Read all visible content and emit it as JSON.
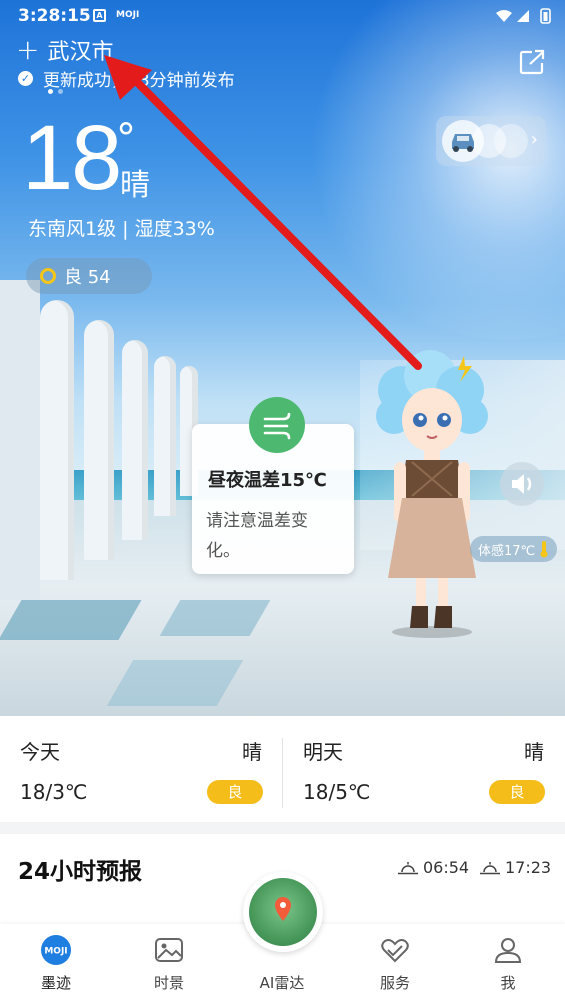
{
  "status_bar": {
    "time": "3:28:15",
    "app_icon_a": "A",
    "app_icon_moji": "MOJI"
  },
  "header": {
    "city": "武汉市",
    "update_status": "更新成功，53分钟前发布",
    "page_count": 2,
    "active_page": 1
  },
  "current": {
    "temperature": "18",
    "degree_symbol": "°",
    "condition": "晴",
    "wind_humidity": "东南风1级 | 湿度33%",
    "aqi": "良 54"
  },
  "tip": {
    "title": "昼夜温差15℃",
    "body": "请注意温差变化。"
  },
  "feels_like": "体感17℃",
  "daily": {
    "today": {
      "name": "今天",
      "condition": "晴",
      "temp": "18/3℃",
      "aqi": "良"
    },
    "tomorrow": {
      "name": "明天",
      "condition": "晴",
      "temp": "18/5℃",
      "aqi": "良"
    }
  },
  "hourly": {
    "title": "24小时预报",
    "sunrise": "06:54",
    "sunset": "17:23"
  },
  "nav": {
    "items": [
      {
        "label": "墨迹",
        "icon": "moji-logo-icon"
      },
      {
        "label": "时景",
        "icon": "image-icon"
      },
      {
        "label": "AI雷达",
        "icon": "radar-pin-icon"
      },
      {
        "label": "服务",
        "icon": "heart-hands-icon"
      },
      {
        "label": "我",
        "icon": "user-icon"
      }
    ],
    "active": "墨迹",
    "moji_logo": "MOJI"
  },
  "colors": {
    "accent_blue": "#1f7fe0",
    "aqi_yellow": "#f5bd1a",
    "tip_green": "#4db86f",
    "arrow_red": "#e31b1b"
  }
}
